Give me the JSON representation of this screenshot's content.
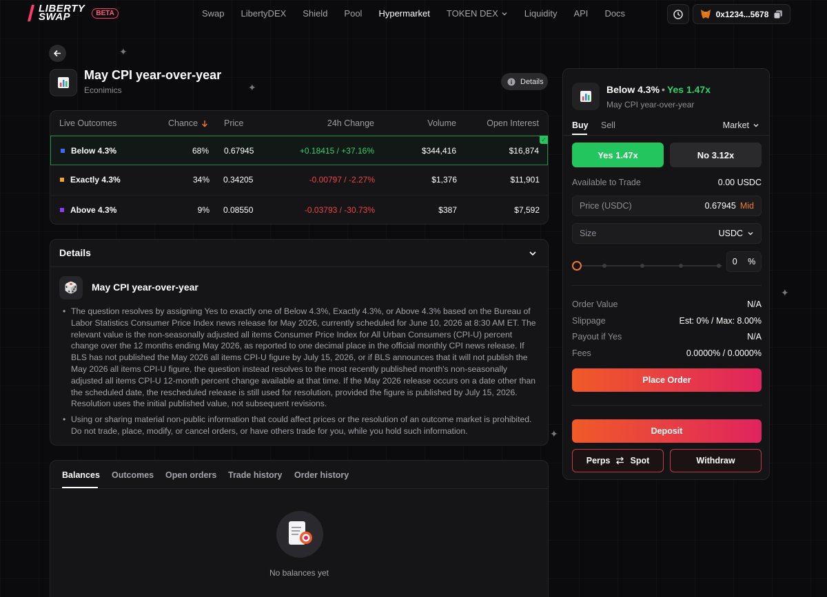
{
  "brand": {
    "name_line1": "LIBERTY",
    "name_line2": "SWAP",
    "badge": "BETA"
  },
  "nav": {
    "items": [
      "Swap",
      "LibertyDEX",
      "Shield",
      "Pool",
      "Hypermarket",
      "TOKEN DEX",
      "Liquidity",
      "API",
      "Docs"
    ],
    "active": "Hypermarket"
  },
  "wallet": {
    "address": "0x1234...5678"
  },
  "market": {
    "title": "May CPI year-over-year",
    "category": "Econimics",
    "details_button": "Details"
  },
  "outcomes_table": {
    "headers": {
      "outcome": "Live Outcomes",
      "chance": "Chance",
      "price": "Price",
      "change": "24h Change",
      "volume": "Volume",
      "open_interest": "Open Interest"
    },
    "rows": [
      {
        "name": "Below 4.3%",
        "chance": "68%",
        "price": "0.67945",
        "change": "+0.18415 / +37.16%",
        "volume": "$344,416",
        "open_interest": "$16,874",
        "color": "#3b6cf6",
        "selected": true
      },
      {
        "name": "Exactly 4.3%",
        "chance": "34%",
        "price": "0.34205",
        "change": "-0.00797 / -2.27%",
        "volume": "$1,376",
        "open_interest": "$11,901",
        "color": "#f5a524"
      },
      {
        "name": "Above 4.3%",
        "chance": "9%",
        "price": "0.08550",
        "change": "-0.03793 / -30.73%",
        "volume": "$387",
        "open_interest": "$7,592",
        "color": "#8b3cf6"
      }
    ]
  },
  "details": {
    "heading": "Details",
    "subtitle": "May CPI year-over-year",
    "bullets": [
      "The question resolves by assigning Yes to exactly one of Below 4.3%, Exactly 4.3%, or Above 4.3% based on the Bureau of Labor Statistics Consumer Price Index news release for May 2026, currently scheduled for June 10, 2026 at 8:30 AM ET. The relevant value is the non-seasonally adjusted all items Consumer Price Index for All Urban Consumers (CPI-U) percent change over the 12 months ending May 2026, as reported to one decimal place in the official monthly CPI news release. If BLS has not published the May 2026 all items CPI-U figure by July 15, 2026, or if BLS announces that it will not publish the May 2026 all items CPI-U figure, the question instead resolves to the most recently published month's non-seasonally adjusted all items CPI-U 12-month percent change available at that time. If the May 2026 release occurs on a date other than the scheduled date, the rescheduled release is still used for resolution, provided the figure is published by July 15, 2026. Resolution uses the initial published value, not subsequent revisions.",
      "Using or sharing material non-public information that could affect prices or the resolution of an outcome market is prohibited. Do not trade, place, modify, or cancel orders, or have others trade for you, while you hold such information."
    ]
  },
  "balances": {
    "tabs": [
      "Balances",
      "Outcomes",
      "Open orders",
      "Trade history",
      "Order history"
    ],
    "active_tab": "Balances",
    "empty_text": "No balances yet"
  },
  "order_panel": {
    "outcome": "Below 4.3%",
    "separator": "•",
    "yes_label": "Yes 1.47x",
    "subtitle": "May CPI year-over-year",
    "buy": "Buy",
    "sell": "Sell",
    "order_type": "Market",
    "yes_button": "Yes 1.47x",
    "no_button": "No 3.12x",
    "available_label": "Available to Trade",
    "available_value": "0.00 USDC",
    "price_label": "Price (USDC)",
    "price_value": "0.67945",
    "price_mid": "Mid",
    "size_label": "Size",
    "size_unit": "USDC",
    "slider_percent": 0,
    "percent_value": "0",
    "percent_sign": "%",
    "order_value_label": "Order Value",
    "order_value": "N/A",
    "slippage_label": "Slippage",
    "slippage_value": "Est: 0% / Max: 8.00%",
    "payout_label": "Payout if Yes",
    "payout_value": "N/A",
    "fees_label": "Fees",
    "fees_value": "0.0000% / 0.0000%",
    "place_order": "Place Order",
    "deposit": "Deposit",
    "perps": "Perps",
    "spot": "Spot",
    "withdraw": "Withdraw"
  },
  "colors": {
    "accent_green": "#22c55e",
    "accent_orange": "#f05a28",
    "accent_pink": "#e0245e",
    "negative": "#f04545"
  },
  "icons": [
    "history-clock-icon",
    "metamask-fox-icon",
    "copy-icon",
    "back-arrow-icon",
    "chart-icon",
    "info-icon",
    "sort-down-icon",
    "chevron-down-icon",
    "dice-icon",
    "document-icon",
    "swap-arrows-icon"
  ]
}
